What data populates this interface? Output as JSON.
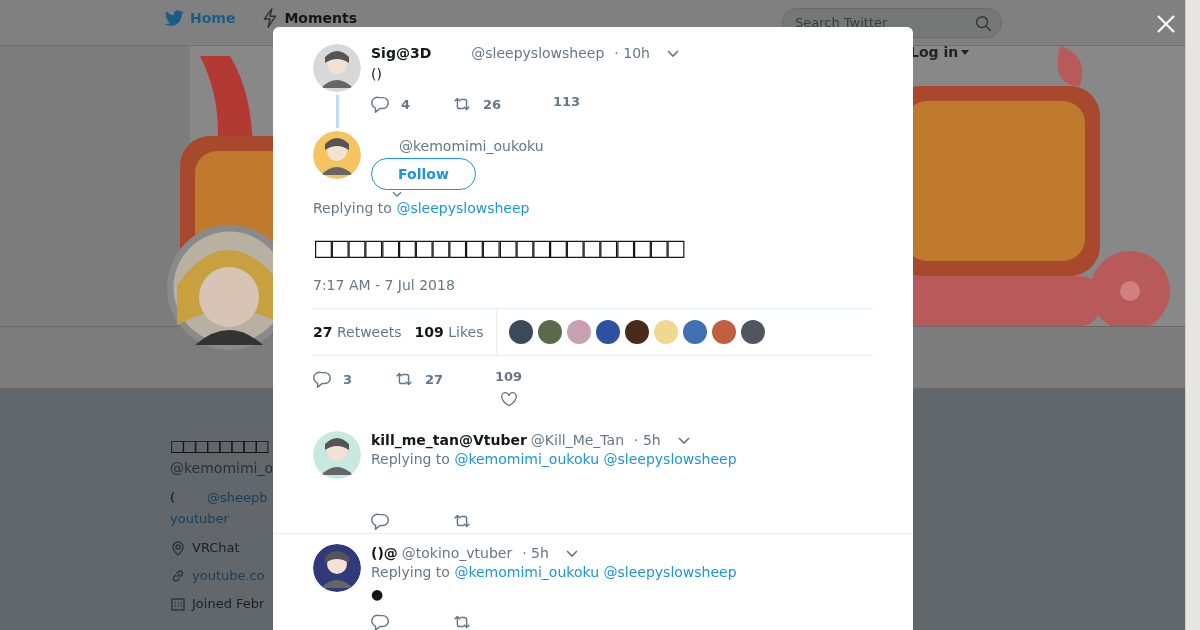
{
  "header": {
    "nav": [
      {
        "kind": "bird",
        "label": "Home"
      },
      {
        "kind": "bolt",
        "label": "Moments"
      }
    ],
    "search": {
      "placeholder": "Search Twitter"
    },
    "login": "Log in"
  },
  "profile": {
    "name": "□□□□□□□□",
    "handle": "@kemomimi_o",
    "bio_prefix": "(",
    "bio_mention": "@sheepb",
    "bio_link": "youtuber",
    "location": "VRChat",
    "website": "youtube.co",
    "joined": "Joined Febr"
  },
  "modal": {
    "parent": {
      "name": "Sig@3D",
      "handle": "@sleepyslowsheep",
      "time": "· 10h",
      "text": "()",
      "replies": "4",
      "retweets": "26",
      "likes": "113"
    },
    "tweet": {
      "handle": "@kemomimi_oukoku",
      "follow": "Follow",
      "replying_label": "Replying to",
      "replying_to": [
        "@sleepyslowsheep"
      ],
      "text": "□□□□□□□□□□□□□□□□□□□□□□",
      "timestamp": "7:17 AM - 7 Jul 2018",
      "retweet_count": "27",
      "retweet_label": "Retweets",
      "like_count": "109",
      "like_label": "Likes",
      "likers": [
        {
          "color": "#3a4a5a"
        },
        {
          "color": "#5a6a4a"
        },
        {
          "color": "#c8a0b0"
        },
        {
          "color": "#3050a0"
        },
        {
          "color": "#4a2a1a"
        },
        {
          "color": "#f0d890"
        },
        {
          "color": "#4070b0"
        },
        {
          "color": "#c06040"
        },
        {
          "color": "#505560"
        }
      ],
      "replies": "3",
      "retweets": "27",
      "likes": "109"
    },
    "replies": [
      {
        "name": "kill_me_tan@Vtuber",
        "handle": "@Kill_Me_Tan",
        "time": "· 5h",
        "replying_label": "Replying to",
        "replying_to": [
          "@kemomimi_oukoku",
          "@sleepyslowsheep"
        ]
      },
      {
        "name": "()@",
        "handle": "@tokino_vtuber",
        "time": "· 5h",
        "replying_label": "Replying to",
        "replying_to": [
          "@kemomimi_oukoku",
          "@sleepyslowsheep"
        ],
        "text": "●"
      }
    ]
  }
}
